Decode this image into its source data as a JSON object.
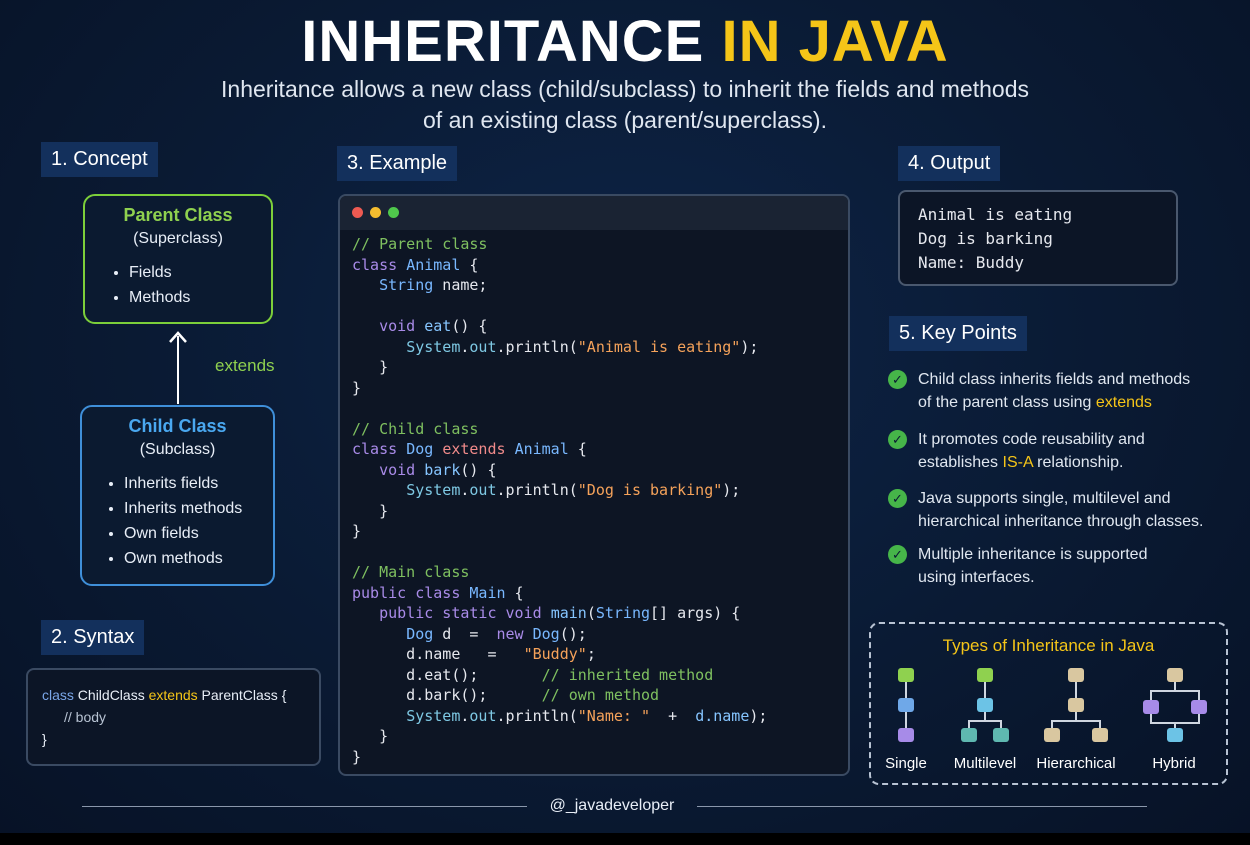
{
  "title": {
    "main": "INHERITANCE",
    "accent": "IN JAVA"
  },
  "subtitle_line1": "Inheritance allows a new class (child/subclass) to inherit the fields and methods",
  "subtitle_line2": "of an existing class (parent/superclass).",
  "concept": {
    "label": "1. Concept",
    "parent": {
      "title": "Parent Class",
      "sub": "(Superclass)",
      "items": [
        "Fields",
        "Methods"
      ]
    },
    "extends": "extends",
    "child": {
      "title": "Child Class",
      "sub": "(Subclass)",
      "items": [
        "Inherits fields",
        "Inherits methods",
        "Own fields",
        "Own methods"
      ]
    }
  },
  "syntax": {
    "label": "2. Syntax",
    "kw_class": "class",
    "child_name": "ChildClass",
    "kw_extends": "extends",
    "parent_name": "ParentClass {",
    "body": "// body",
    "close": "}"
  },
  "example": {
    "label": "3. Example"
  },
  "output": {
    "label": "4. Output",
    "lines": [
      "Animal is eating",
      "Dog is barking",
      "Name: Buddy"
    ]
  },
  "key_points": {
    "label": "5. Key Points",
    "items": [
      {
        "line1": "Child class inherits fields and methods",
        "line2_pre": "of the parent class using ",
        "line2_hl": "extends",
        "line2_post": ""
      },
      {
        "line1": "It promotes code reusability and",
        "line2_pre": "establishes ",
        "line2_hl": "IS-A",
        "line2_post": " relationship."
      },
      {
        "line1": "Java supports single, multilevel and",
        "line2_pre": "hierarchical inheritance through classes.",
        "line2_hl": "",
        "line2_post": ""
      },
      {
        "line1": "Multiple inheritance is supported",
        "line2_pre": "using interfaces.",
        "line2_hl": "",
        "line2_post": ""
      }
    ]
  },
  "types": {
    "title": "Types of Inheritance in Java",
    "labels": [
      "Single",
      "Multilevel",
      "Hierarchical",
      "Hybrid"
    ],
    "colors": {
      "green": "#8fd14f",
      "blue": "#6fa8e8",
      "purple": "#a78be8",
      "teal": "#5fb8b0",
      "tan": "#d9c7a0",
      "cyan": "#6cc3e6"
    }
  },
  "footer": "@_javadeveloper"
}
